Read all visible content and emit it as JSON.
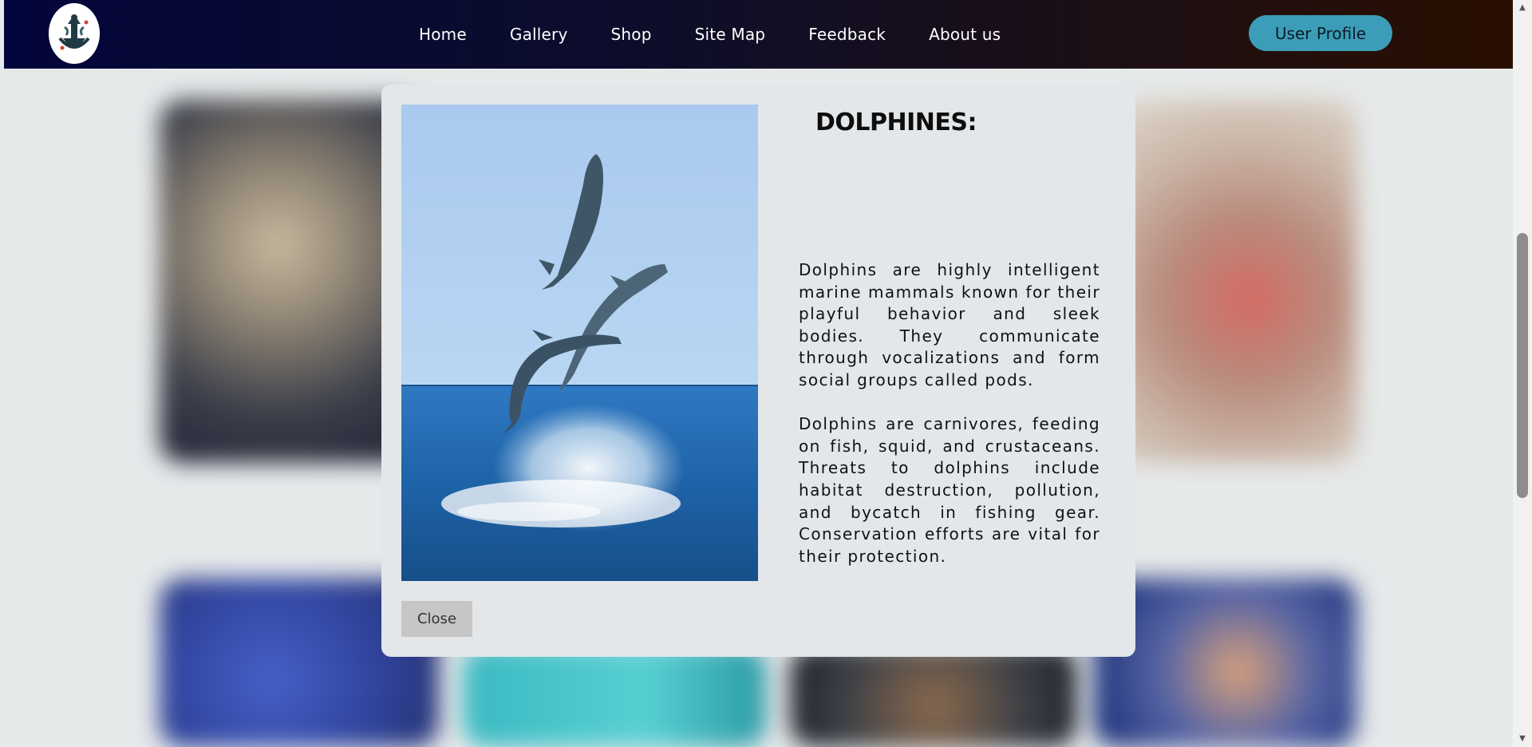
{
  "nav": {
    "logo_icon": "anchor-logo-icon",
    "links": [
      {
        "label": "Home"
      },
      {
        "label": "Gallery"
      },
      {
        "label": "Shop"
      },
      {
        "label": "Site Map"
      },
      {
        "label": "Feedback"
      },
      {
        "label": "About us"
      }
    ],
    "profile_label": "User Profile",
    "profile_color": "#3c9db8"
  },
  "modal": {
    "title": "DOLPHINES:",
    "paragraphs": [
      "Dolphins are highly intelligent marine mammals known for their playful behavior and sleek bodies. They communicate through vocalizations and form social groups called pods.",
      "Dolphins are carnivores, feeding on fish, squid, and crustaceans. Threats to dolphins include habitat destruction, pollution, and bycatch in fishing gear. Conservation efforts are vital for their protection."
    ],
    "close_label": "Close",
    "image_icon": "dolphins-photo"
  },
  "colors": {
    "nav_start": "#03063a",
    "nav_end": "#2a0f00",
    "modal_bg": "#e3e7e9",
    "page_bg": "#e6e9ea"
  }
}
